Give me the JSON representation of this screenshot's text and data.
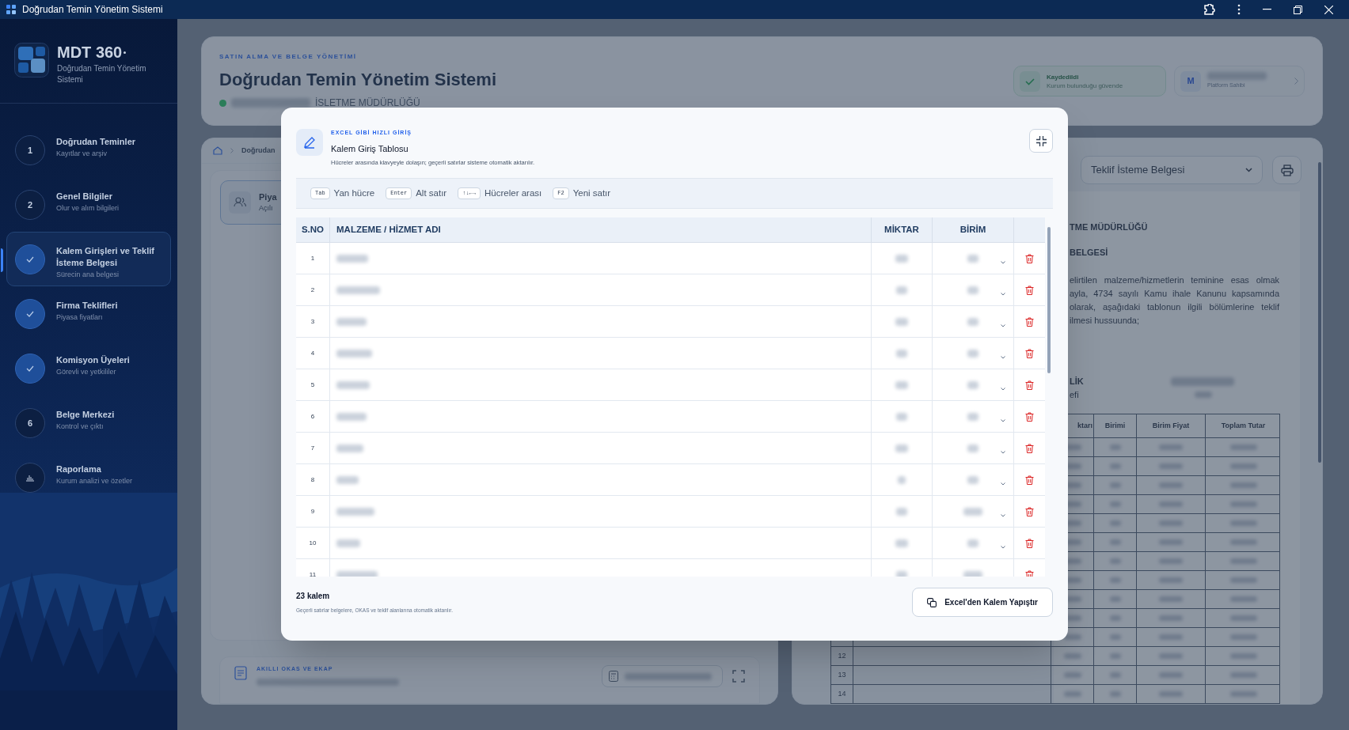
{
  "window": {
    "title": "Doğrudan Temin Yönetim Sistemi"
  },
  "brand": {
    "name": "MDT 360",
    "subtitle": "Doğrudan Temin Yönetim Sistemi"
  },
  "steps": [
    {
      "kind": "number",
      "number": "1",
      "title": "Doğrudan Teminler",
      "subtitle": "Kayıtlar ve arşiv",
      "selected": false
    },
    {
      "kind": "number",
      "number": "2",
      "title": "Genel Bilgiler",
      "subtitle": "Olur ve alım bilgileri",
      "selected": false
    },
    {
      "kind": "done",
      "title": "Kalem Girişleri ve Teklif İsteme Belgesi",
      "subtitle": "Sürecin ana belgesi",
      "selected": true
    },
    {
      "kind": "done",
      "title": "Firma Teklifleri",
      "subtitle": "Piyasa fiyatları",
      "selected": false
    },
    {
      "kind": "done",
      "title": "Komisyon Üyeleri",
      "subtitle": "Görevli ve yetkililer",
      "selected": false
    },
    {
      "kind": "number",
      "number": "6",
      "title": "Belge Merkezi",
      "subtitle": "Kontrol ve çıktı",
      "selected": false
    },
    {
      "kind": "chart",
      "title": "Raporlama",
      "subtitle": "Kurum analizi ve özetler",
      "selected": false
    }
  ],
  "header": {
    "eyebrow": "SATIN ALMA VE BELGE YÖNETİMİ",
    "title": "Doğrudan Temin Yönetim Sistemi",
    "org": "İSLETME MÜDÜRLÜĞÜ",
    "save_status": {
      "title": "Kaydedildi",
      "subtitle": "Kurum bulunduğu güvende"
    },
    "user": {
      "initial": "M",
      "role": "Platform Sahibi"
    }
  },
  "breadcrumb": [
    "Doğrudan"
  ],
  "panel_card": {
    "title": "Piya",
    "subtitle": "Açılı"
  },
  "bottom_card": {
    "eyebrow": "AKILLI OKAS VE EKAP"
  },
  "document": {
    "selector": "Teklif İsteme Belgesi",
    "heading": "TME MÜDÜRLÜĞÜ",
    "subheading": "BELGESİ",
    "paragraph": [
      "elirtilen malzeme/hizmetlerin teminine esas olmak",
      "ayla, 4734 sayılı Kamu ihale Kanunu kapsamında",
      "olarak, aşağıdaki tablonun ilgili bölümlerine teklif",
      "ilmesi hussuunda;"
    ],
    "signature": [
      "LİK",
      "efi"
    ],
    "table": {
      "columns": [
        "ktarı",
        "Birimi",
        "Birim Fiyat",
        "Toplam Tutar"
      ],
      "rows": [
        {},
        {},
        {},
        {},
        {},
        {},
        {},
        {},
        {},
        {},
        {},
        {
          "no": "12"
        },
        {
          "no": "13"
        },
        {
          "no": "14"
        }
      ]
    }
  },
  "modal": {
    "eyebrow": "EXCEL GİBİ HIZLI GİRİŞ",
    "title": "Kalem Giriş Tablosu",
    "description": "Hücreler arasında klavyeyle dolaşın; geçerli satırlar sisteme otomatik aktarılır.",
    "shortcuts": [
      {
        "key": "Tab",
        "label": "Yan hücre"
      },
      {
        "key": "Enter",
        "label": "Alt satır"
      },
      {
        "key": "↑↓←→",
        "label": "Hücreler arası"
      },
      {
        "key": "F2",
        "label": "Yeni satır"
      }
    ],
    "columns": [
      "S.NO",
      "MALZEME / HİZMET ADI",
      "MİKTAR",
      "BİRİM"
    ],
    "rows": [
      {
        "no": "1"
      },
      {
        "no": "2"
      },
      {
        "no": "3"
      },
      {
        "no": "4"
      },
      {
        "no": "5"
      },
      {
        "no": "6"
      },
      {
        "no": "7"
      },
      {
        "no": "8"
      },
      {
        "no": "9"
      },
      {
        "no": "10"
      },
      {
        "no": "11"
      }
    ],
    "count": "23 kalem",
    "footnote": "Geçerli satırlar belgelere, OKAS ve teklif alanlarına otomatik aktarılır.",
    "paste_button": "Excel'den Kalem Yapıştır"
  }
}
